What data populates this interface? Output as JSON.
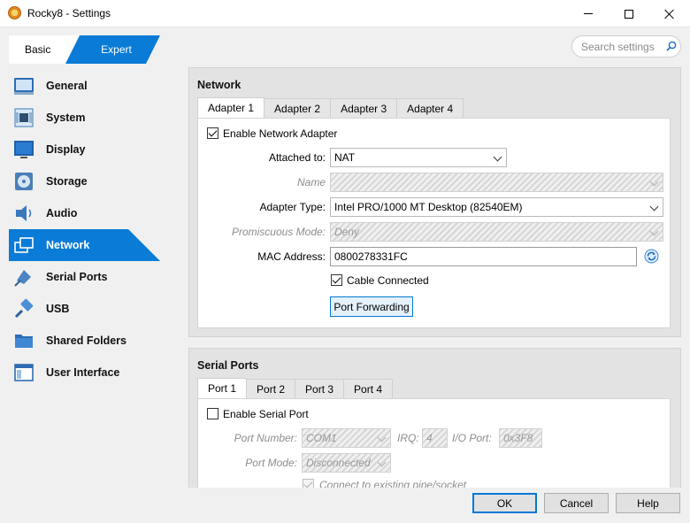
{
  "window": {
    "title": "Rocky8 - Settings"
  },
  "mode": {
    "basic_label": "Basic",
    "expert_label": "Expert",
    "accent": "#0a7bd6"
  },
  "search": {
    "placeholder": "Search settings"
  },
  "sidebar": {
    "items": [
      {
        "label": "General",
        "icon": "general-icon"
      },
      {
        "label": "System",
        "icon": "system-chip-icon"
      },
      {
        "label": "Display",
        "icon": "display-monitor-icon"
      },
      {
        "label": "Storage",
        "icon": "storage-disk-icon"
      },
      {
        "label": "Audio",
        "icon": "audio-speaker-icon"
      },
      {
        "label": "Network",
        "icon": "network-icon",
        "active": true
      },
      {
        "label": "Serial Ports",
        "icon": "serial-port-icon"
      },
      {
        "label": "USB",
        "icon": "usb-icon"
      },
      {
        "label": "Shared Folders",
        "icon": "folder-icon"
      },
      {
        "label": "User Interface",
        "icon": "user-interface-icon"
      }
    ]
  },
  "network": {
    "title": "Network",
    "tabs": [
      "Adapter 1",
      "Adapter 2",
      "Adapter 3",
      "Adapter 4"
    ],
    "enable_label": "Enable Network Adapter",
    "attached_label": "Attached to:",
    "attached_value": "NAT",
    "name_label": "Name",
    "name_value": "",
    "adapter_type_label": "Adapter Type:",
    "adapter_type_value": "Intel PRO/1000 MT Desktop (82540EM)",
    "promiscuous_label": "Promiscuous Mode:",
    "promiscuous_value": "Deny",
    "mac_label": "MAC Address:",
    "mac_value": "0800278331FC",
    "cable_label": "Cable Connected",
    "port_forwarding_label": "Port Forwarding"
  },
  "serial": {
    "title": "Serial Ports",
    "tabs": [
      "Port 1",
      "Port 2",
      "Port 3",
      "Port 4"
    ],
    "enable_label": "Enable Serial Port",
    "port_number_label": "Port Number:",
    "port_number_value": "COM1",
    "irq_label": "IRQ:",
    "irq_value": "4",
    "io_port_label": "I/O Port:",
    "io_port_value": "0x3F8",
    "port_mode_label": "Port Mode:",
    "port_mode_value": "Disconnected",
    "connect_pipe_label": "Connect to existing pipe/socket"
  },
  "buttons": {
    "ok": "OK",
    "cancel": "Cancel",
    "help": "Help"
  }
}
